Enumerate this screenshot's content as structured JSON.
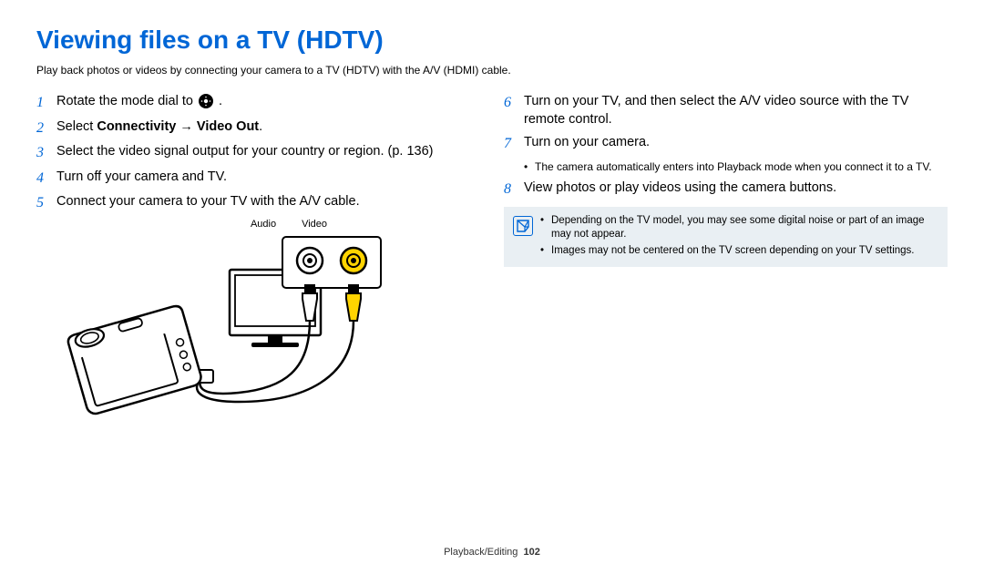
{
  "title": "Viewing files on a TV (HDTV)",
  "intro": "Play back photos or videos by connecting your camera to a TV (HDTV) with the A/V (HDMI) cable.",
  "steps_left": [
    {
      "num": "1",
      "text_pre": "Rotate the mode dial to ",
      "has_icon": true,
      "text_post": "."
    },
    {
      "num": "2",
      "text_pre": "Select ",
      "bold": "Connectivity → Video Out",
      "text_post": "."
    },
    {
      "num": "3",
      "text_pre": "Select the video signal output for your country or region. (p. 136)"
    },
    {
      "num": "4",
      "text_pre": "Turn off your camera and TV."
    },
    {
      "num": "5",
      "text_pre": "Connect your camera to your TV with the A/V cable."
    }
  ],
  "diagram_labels": {
    "audio": "Audio",
    "video": "Video"
  },
  "steps_right": [
    {
      "num": "6",
      "text_pre": "Turn on your TV, and then select the A/V video source with the TV remote control."
    },
    {
      "num": "7",
      "text_pre": "Turn on your camera.",
      "sub": [
        "The camera automatically enters into Playback mode when you connect it to a TV."
      ]
    },
    {
      "num": "8",
      "text_pre": "View photos or play videos using the camera buttons."
    }
  ],
  "notes": [
    "Depending on the TV model, you may see some digital noise or part of an image may not appear.",
    "Images may not be centered on the TV screen depending on your TV settings."
  ],
  "footer": {
    "section": "Playback/Editing",
    "page": "102"
  }
}
